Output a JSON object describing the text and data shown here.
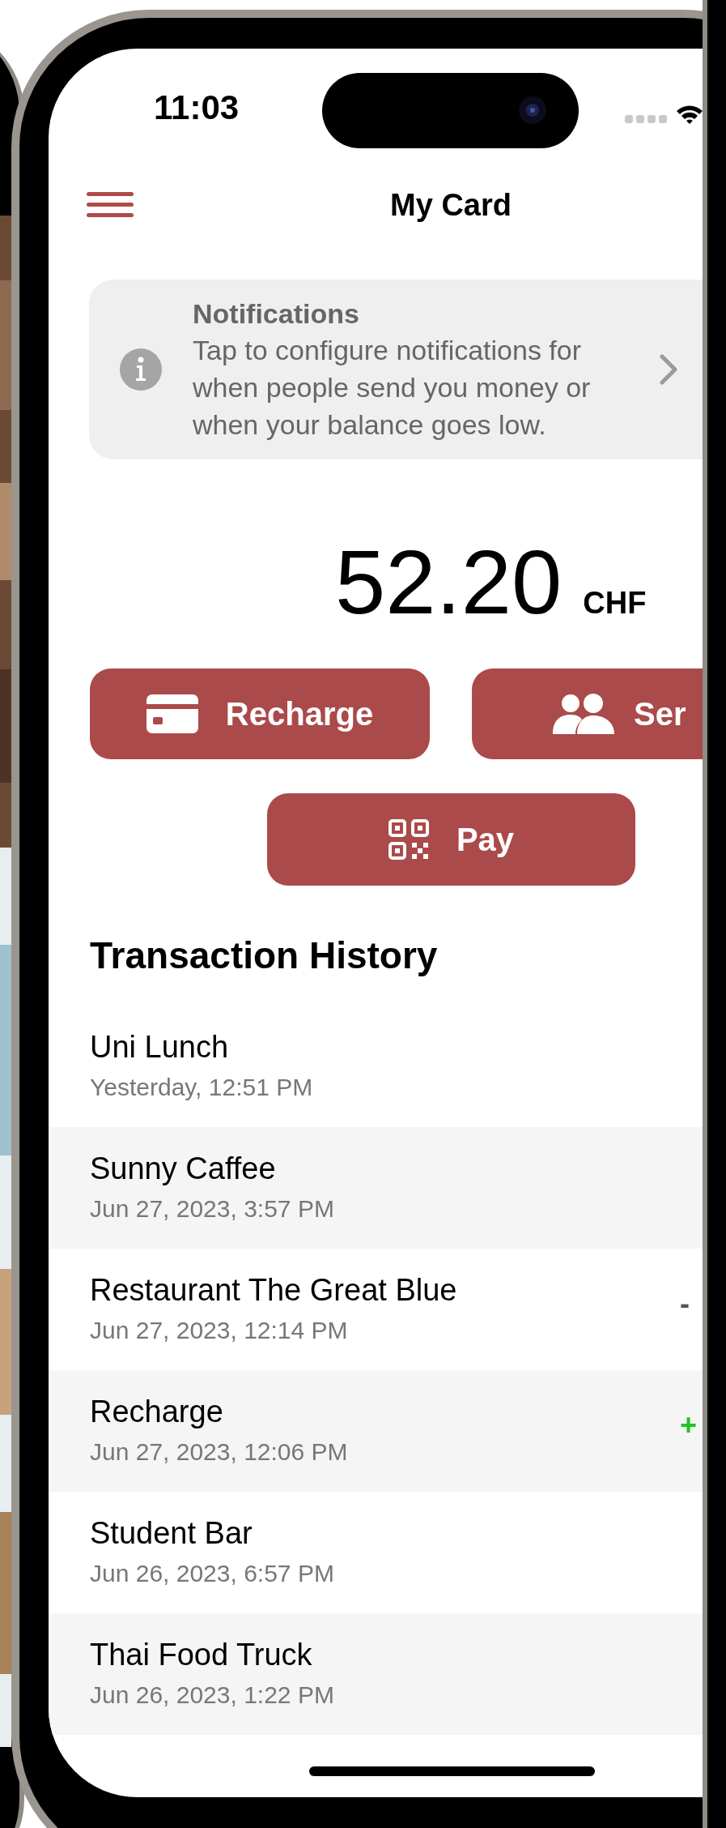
{
  "status_bar": {
    "time": "11:03"
  },
  "nav": {
    "title": "My Card"
  },
  "notification": {
    "title": "Notifications",
    "body": "Tap to configure notifications for when people send you money or when your balance goes low."
  },
  "balance": {
    "amount": "52.20",
    "currency": "CHF"
  },
  "actions": [
    {
      "kind": "card",
      "label": "Recharge"
    },
    {
      "kind": "people",
      "label": "Ser"
    },
    {
      "kind": "qr",
      "label": "Pay"
    }
  ],
  "history": {
    "title": "Transaction History",
    "rows": [
      {
        "name": "Uni Lunch",
        "date": "Yesterday, 12:51 PM"
      },
      {
        "name": "Sunny Caffee",
        "date": "Jun 27, 2023, 3:57 PM"
      },
      {
        "name": "Restaurant The Great Blue",
        "date": "Jun 27, 2023, 12:14 PM",
        "amount": "-",
        "credit": false
      },
      {
        "name": "Recharge",
        "date": "Jun 27, 2023, 12:06 PM",
        "amount": "+",
        "credit": true
      },
      {
        "name": "Student Bar",
        "date": "Jun 26, 2023, 6:57 PM"
      },
      {
        "name": "Thai Food Truck",
        "date": "Jun 26, 2023, 1:22 PM"
      }
    ]
  }
}
